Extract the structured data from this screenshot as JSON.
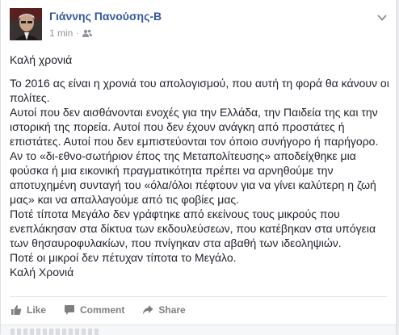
{
  "post": {
    "author": "Γιάννης Πανούσης-Β",
    "time": "1 min",
    "privacy_icon": "friends-icon",
    "paragraphs": [
      "Καλή χρονιά",
      "Το 2016 ας είναι η χρονιά του απολογισμού, που αυτή τη φορά θα κάνουν οι πολίτες.\nΑυτοί που δεν αισθάνονται ενοχές για την Ελλάδα, την Παιδεία της και την ιστορική της πορεία. Αυτοί που δεν έχουν ανάγκη από προστάτες ή επιστάτες. Αυτοί που δεν εμπιστεύονται τον όποιο συνήγορο ή παρήγορο.\nΑν το «δι-εθνο-σωτήριον έπος της Μεταπολίτευσης» αποδείχθηκε μια φούσκα ή μια εικονική πραγματικότητα πρέπει να αρνηθούμε την αποτυχημένη συνταγή του «όλα/όλοι πέφτουν για να γίνει καλύτερη η ζωή μας» και να απαλλαγούμε από τις φοβίες μας.\nΠοτέ τίποτα Μεγάλο δεν γράφτηκε από εκείνους τους μικρούς που ενεπλάκησαν στα δίκτυα των εκδουλεύσεων, που κατέβηκαν στα υπόγεια των θησαυροφυλακίων, που πνίγηκαν στα αβαθή των ιδεοληψιών.\nΠοτέ οι μικροί δεν πέτυχαν τίποτα το Μεγάλο.\nΚαλή Χρονιά"
    ]
  },
  "actions": {
    "like": "Like",
    "comment": "Comment",
    "share": "Share"
  },
  "colors": {
    "author": "#365899",
    "meta": "#90949c",
    "text": "#1d2129",
    "action": "#7f7f7f"
  }
}
